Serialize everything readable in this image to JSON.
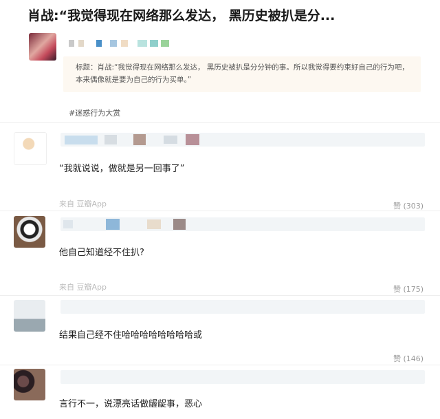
{
  "post": {
    "title": "肖战:“我觉得现在网络那么发达， 黑历史被扒是分...",
    "quote": "标题：肖战:“我觉得现在网络那么发达， 黑历史被扒是分分钟的事。所以我觉得要约束好自己的行为吧，本来偶像就是要为自己的行为买单。”",
    "hashtag": "#迷惑行为大赏"
  },
  "comments": [
    {
      "text": "“我就说说，做就是另一回事了”",
      "source": "来自 豆瓣App",
      "likes": "赞 (303)"
    },
    {
      "text": "他自己知道经不住扒?",
      "source": "来自 豆瓣App",
      "likes": "赞 (175)"
    },
    {
      "text": "结果自己经不住哈哈哈哈哈哈哈哈或",
      "source": "",
      "likes": "赞 (146)"
    },
    {
      "text": "言行不一，说漂亮话做龌龊事，恶心",
      "source": "",
      "likes": ""
    }
  ],
  "colors": {
    "background": "#ffffff",
    "quote_bg": "#fdf8f1",
    "muted": "#bbbbbb"
  }
}
